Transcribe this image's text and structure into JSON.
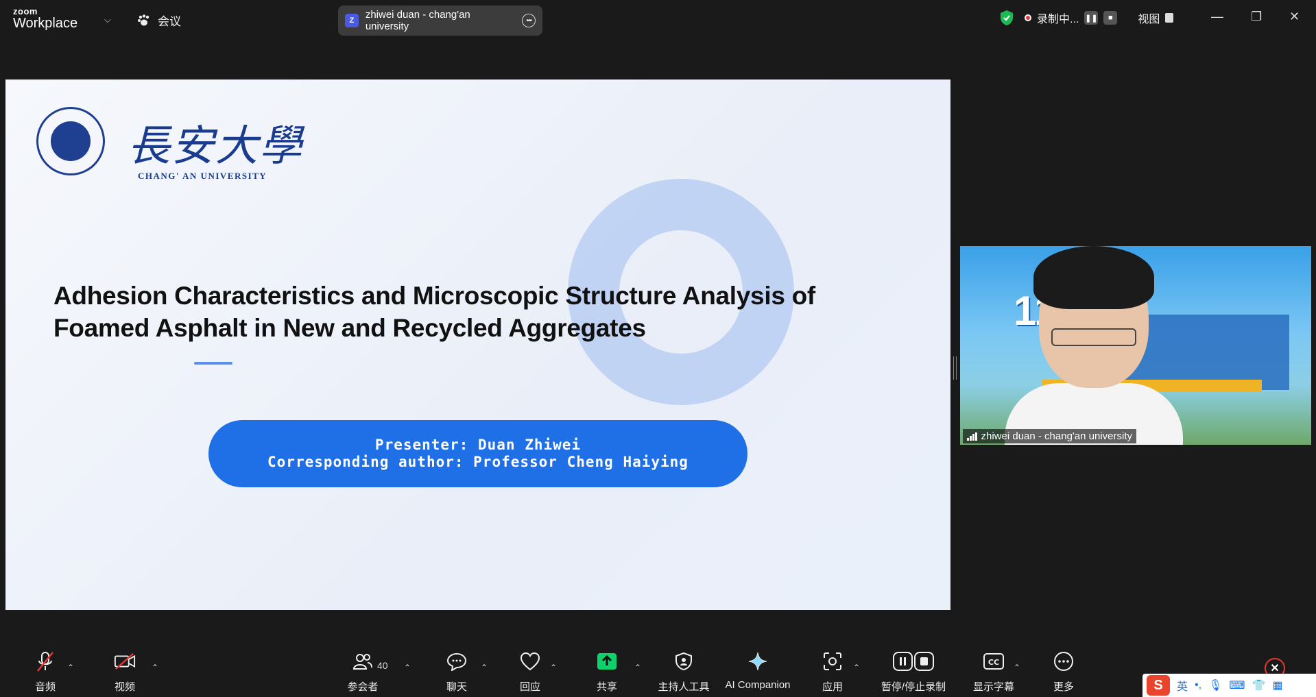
{
  "app": {
    "brand_top": "zoom",
    "brand_bottom": "Workplace",
    "meeting_menu": "会议"
  },
  "title_pill": {
    "badge": "Z",
    "text": "zhiwei duan - chang'an university"
  },
  "recording": {
    "label": "录制中...",
    "view": "视图"
  },
  "slide": {
    "university_cn": "長安大學",
    "university_en": "CHANG' AN UNIVERSITY",
    "title_line1": "Adhesion Characteristics and Microscopic Structure Analysis of",
    "title_line2": "Foamed Asphalt in New and Recycled Aggregates",
    "presenter": "Presenter: Duan Zhiwei",
    "corresponding": "Corresponding author: Professor Cheng Haiying"
  },
  "video": {
    "name": "zhiwei duan - chang'an university",
    "bg_number": "11"
  },
  "toolbar": {
    "audio": "音频",
    "video": "视频",
    "participants": "参会者",
    "participants_count": "40",
    "chat": "聊天",
    "react": "回应",
    "share": "共享",
    "host_tools": "主持人工具",
    "ai": "AI Companion",
    "apps": "应用",
    "pause_record": "暂停/停止录制",
    "captions": "显示字幕",
    "more": "更多"
  },
  "ime": {
    "lang": "英"
  },
  "colors": {
    "accent_blue": "#1f6fe6",
    "share_green": "#0fd16b",
    "record_red": "#e53935",
    "shield_green": "#1db954"
  }
}
